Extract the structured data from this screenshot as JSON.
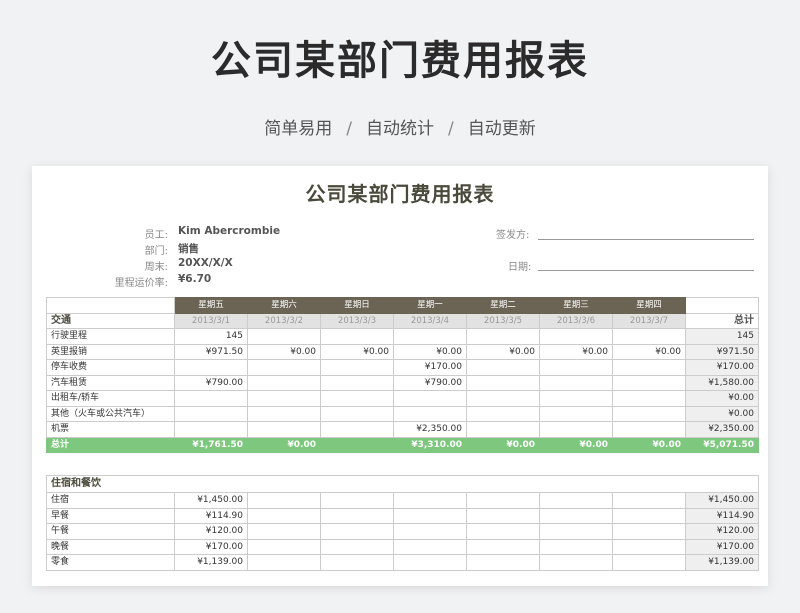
{
  "page": {
    "title": "公司某部门费用报表",
    "tags": [
      "简单易用",
      "自动统计",
      "自动更新"
    ],
    "separator": "/"
  },
  "sheet": {
    "title": "公司某部门费用报表",
    "info_left": [
      {
        "label": "员工:",
        "value": "Kim Abercrombie"
      },
      {
        "label": "部门:",
        "value": "销售"
      },
      {
        "label": "周末:",
        "value": "20XX/X/X"
      },
      {
        "label": "里程运价率:",
        "value": "¥6.70"
      }
    ],
    "info_right": [
      {
        "label": "签发方:"
      },
      {
        "label": "日期:"
      }
    ],
    "days": [
      "星期五",
      "星期六",
      "星期日",
      "星期一",
      "星期二",
      "星期三",
      "星期四"
    ],
    "dates": [
      "2013/3/1",
      "2013/3/2",
      "2013/3/3",
      "2013/3/4",
      "2013/3/5",
      "2013/3/6",
      "2013/3/7"
    ],
    "total_header": "总计",
    "sections": [
      {
        "name": "交通",
        "rows": [
          {
            "label": "行驶里程",
            "values": [
              "145",
              "",
              "",
              "",
              "",
              "",
              ""
            ],
            "total": "145"
          },
          {
            "label": "英里报销",
            "values": [
              "¥971.50",
              "¥0.00",
              "¥0.00",
              "¥0.00",
              "¥0.00",
              "¥0.00",
              "¥0.00"
            ],
            "total": "¥971.50"
          },
          {
            "label": "停车收费",
            "values": [
              "",
              "",
              "",
              "¥170.00",
              "",
              "",
              ""
            ],
            "total": "¥170.00"
          },
          {
            "label": "汽车租赁",
            "values": [
              "¥790.00",
              "",
              "",
              "¥790.00",
              "",
              "",
              ""
            ],
            "total": "¥1,580.00"
          },
          {
            "label": "出租车/轿车",
            "values": [
              "",
              "",
              "",
              "",
              "",
              "",
              ""
            ],
            "total": "¥0.00"
          },
          {
            "label": "其他（火车或公共汽车）",
            "values": [
              "",
              "",
              "",
              "",
              "",
              "",
              ""
            ],
            "total": "¥0.00"
          },
          {
            "label": "机票",
            "values": [
              "",
              "",
              "",
              "¥2,350.00",
              "",
              "",
              ""
            ],
            "total": "¥2,350.00"
          }
        ],
        "sum": {
          "label": "总计",
          "values": [
            "¥1,761.50",
            "¥0.00",
            "",
            "¥3,310.00",
            "¥0.00",
            "¥0.00",
            "¥0.00"
          ],
          "total": "¥5,071.50"
        }
      },
      {
        "name": "住宿和餐饮",
        "rows": [
          {
            "label": "住宿",
            "values": [
              "¥1,450.00",
              "",
              "",
              "",
              "",
              "",
              ""
            ],
            "total": "¥1,450.00"
          },
          {
            "label": "早餐",
            "values": [
              "¥114.90",
              "",
              "",
              "",
              "",
              "",
              ""
            ],
            "total": "¥114.90"
          },
          {
            "label": "午餐",
            "values": [
              "¥120.00",
              "",
              "",
              "",
              "",
              "",
              ""
            ],
            "total": "¥120.00"
          },
          {
            "label": "晚餐",
            "values": [
              "¥170.00",
              "",
              "",
              "",
              "",
              "",
              ""
            ],
            "total": "¥170.00"
          },
          {
            "label": "零食",
            "values": [
              "¥1,139.00",
              "",
              "",
              "",
              "",
              "",
              ""
            ],
            "total": "¥1,139.00"
          }
        ]
      }
    ]
  }
}
